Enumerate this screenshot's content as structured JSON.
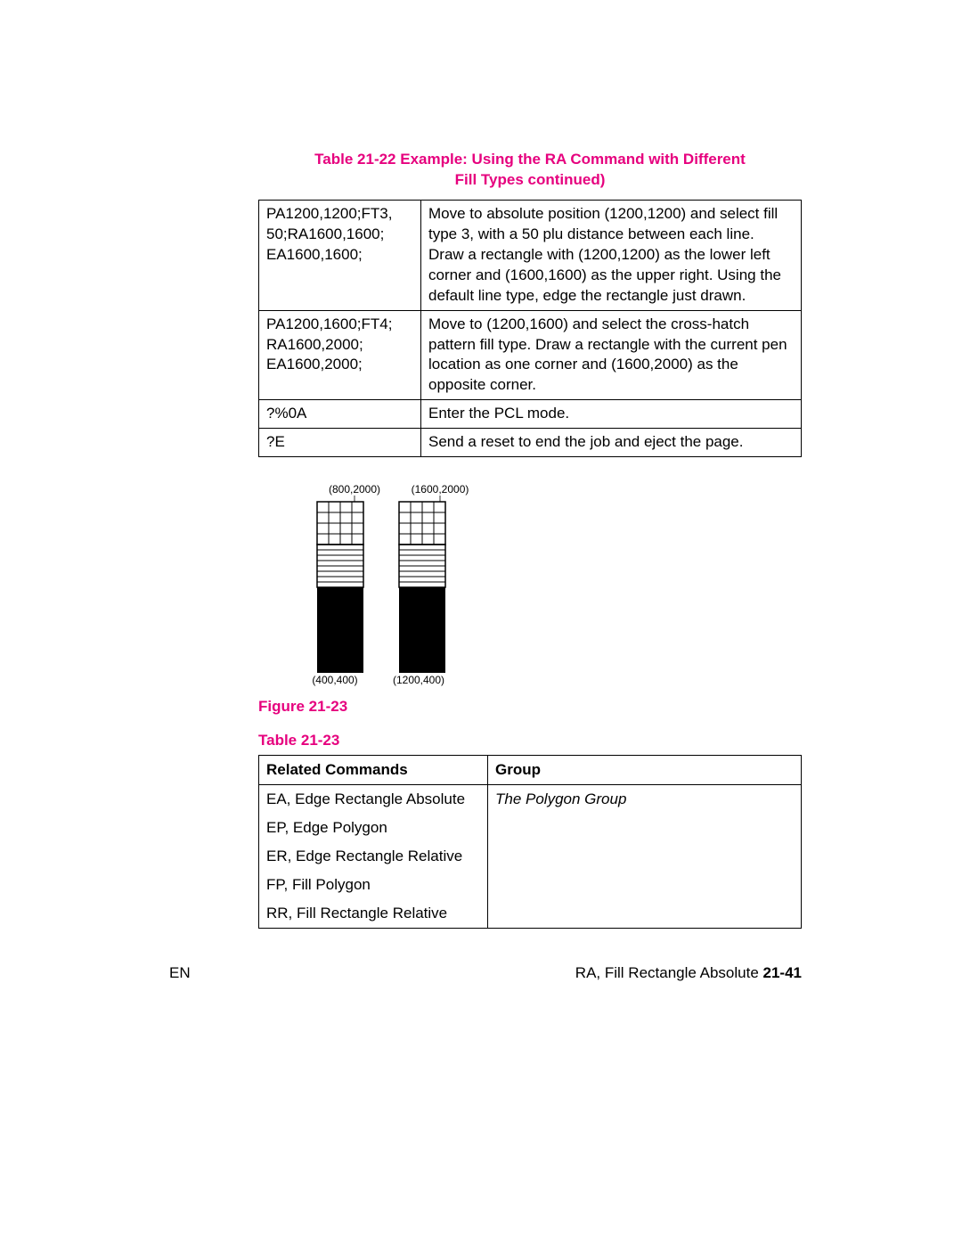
{
  "table1_caption_l1": "Table 21-22  Example: Using the RA Command with Different",
  "table1_caption_l2": "Fill Types continued)",
  "table1": [
    {
      "c": "PA1200,1200;FT3,\n50;RA1600,1600;\nEA1600,1600;",
      "d": "Move to absolute position (1200,1200) and select fill type 3, with a 50 plu distance between each line. Draw a rectangle with (1200,1200) as the lower left corner and (1600,1600) as the upper right. Using the default line type, edge the rectangle just drawn."
    },
    {
      "c": "PA1200,1600;FT4; RA1600,2000;\nEA1600,2000;",
      "d": "Move to (1200,1600) and select the cross-hatch pattern fill type. Draw a rectangle with the current pen location as one corner and (1600,2000) as the opposite corner."
    },
    {
      "c": "?%0A",
      "d": "Enter the PCL mode."
    },
    {
      "c": "?E",
      "d": "Send a reset to end the job and eject the page."
    }
  ],
  "figure_label": "Figure 21-23",
  "figure_coords": {
    "tl": "(800,2000)",
    "tr": "(1600,2000)",
    "bl": "(400,400)",
    "br": "(1200,400)"
  },
  "table2_label": "Table 21-23",
  "table2_headers": {
    "c1": "Related Commands",
    "c2": "Group"
  },
  "table2": [
    {
      "c": "EA, Edge Rectangle Absolute",
      "g": "The Polygon Group"
    },
    {
      "c": "EP, Edge Polygon",
      "g": ""
    },
    {
      "c": "ER, Edge Rectangle Relative",
      "g": ""
    },
    {
      "c": "FP, Fill Polygon",
      "g": ""
    },
    {
      "c": "RR, Fill Rectangle Relative",
      "g": ""
    }
  ],
  "footer_left": "EN",
  "footer_right_text": "RA, Fill Rectangle Absolute ",
  "footer_right_page": "21-41"
}
